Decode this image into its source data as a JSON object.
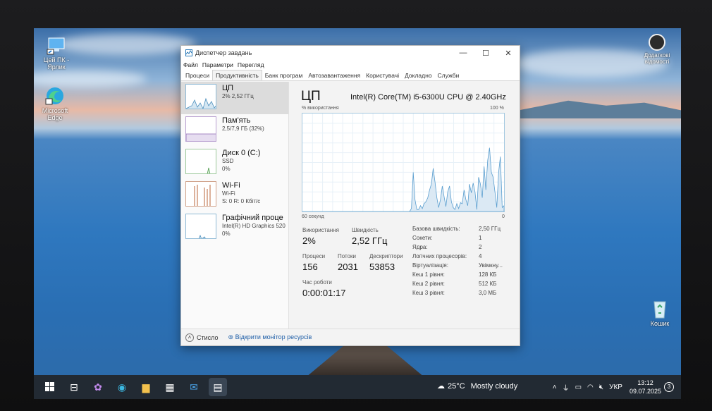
{
  "desktop": {
    "icons": [
      {
        "label": "Цей ПК - Ярлик"
      },
      {
        "label": "Microsoft Edge"
      },
      {
        "label": "Кошик"
      }
    ],
    "notice": "Додаткові відомості"
  },
  "taskmgr": {
    "title": "Диспетчер завдань",
    "menu": [
      "Файл",
      "Параметри",
      "Перегляд"
    ],
    "tabs": [
      "Процеси",
      "Продуктивність",
      "Банк програм",
      "Автозавантаження",
      "Користувачі",
      "Докладно",
      "Служби"
    ],
    "resources": [
      {
        "name": "ЦП",
        "sub1": "2% 2,52 ГГц",
        "sub2": ""
      },
      {
        "name": "Пам'ять",
        "sub1": "2,5/7,9 ГБ (32%)",
        "sub2": ""
      },
      {
        "name": "Диск 0 (C:)",
        "sub1": "SSD",
        "sub2": "0%"
      },
      {
        "name": "Wi-Fi",
        "sub1": "Wi-Fi",
        "sub2": "S: 0 R: 0 Кбіт/с"
      },
      {
        "name": "Графічний проце",
        "sub1": "Intel(R) HD Graphics 520",
        "sub2": "0%"
      }
    ],
    "panel": {
      "title": "ЦП",
      "cpu_name": "Intel(R) Core(TM) i5-6300U CPU @ 2.40GHz",
      "graph_ylabel": "% використання",
      "graph_ymax": "100 %",
      "graph_xlabel": "60 секунд",
      "graph_ymin": "0",
      "usage_label": "Використання",
      "usage": "2%",
      "speed_label": "Швидкість",
      "speed": "2,52 ГГц",
      "proc_label": "Процеси",
      "proc": "156",
      "threads_label": "Потоки",
      "threads": "2031",
      "handles_label": "Дескриптори",
      "handles": "53853",
      "uptime_label": "Час роботи",
      "uptime": "0:00:01:17",
      "details": [
        {
          "k": "Базова швидкість:",
          "v": "2,50 ГГц"
        },
        {
          "k": "Сокети:",
          "v": "1"
        },
        {
          "k": "Ядра:",
          "v": "2"
        },
        {
          "k": "Логічних процесорів:",
          "v": "4"
        },
        {
          "k": "Віртуалізація:",
          "v": "Увімкну..."
        },
        {
          "k": "Кеш 1 рівня:",
          "v": "128 КБ"
        },
        {
          "k": "Кеш 2 рівня:",
          "v": "512 КБ"
        },
        {
          "k": "Кеш 3 рівня:",
          "v": "3,0 МБ"
        }
      ]
    },
    "footer": {
      "fewer": "Стисло",
      "monitor": "Відкрити монітор ресурсів"
    },
    "cpu_history_percent": [
      0,
      0,
      0,
      0,
      0,
      0,
      0,
      0,
      0,
      0,
      0,
      0,
      0,
      0,
      0,
      0,
      0,
      0,
      0,
      0,
      0,
      0,
      0,
      0,
      0,
      0,
      0,
      0,
      0,
      0,
      0,
      0,
      0,
      0,
      0,
      0,
      0,
      0,
      0,
      0,
      0,
      0,
      0,
      0,
      0,
      0,
      0,
      0,
      0,
      0,
      0,
      0,
      0,
      0,
      0,
      0,
      0,
      0,
      0,
      0,
      3,
      40,
      12,
      2,
      2,
      6,
      3,
      8,
      10,
      14,
      22,
      28,
      44,
      30,
      14,
      4,
      12,
      26,
      15,
      5,
      20,
      26,
      10,
      4,
      2,
      8,
      3,
      9,
      8,
      22,
      12,
      6,
      28,
      19,
      29,
      20,
      2,
      35,
      28,
      14,
      46,
      22,
      52,
      65,
      40,
      35,
      20,
      4,
      40,
      56,
      4,
      6
    ]
  },
  "taskbar": {
    "weather_temp": "25°C",
    "weather_text": "Mostly cloudy",
    "lang": "УКР",
    "time": "13:12",
    "date": "09.07.2025",
    "notif_count": "3"
  }
}
